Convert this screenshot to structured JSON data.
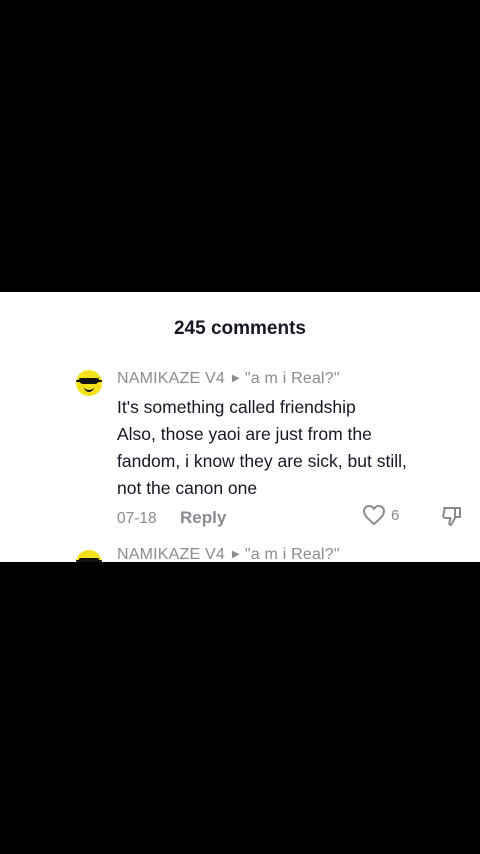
{
  "sheet": {
    "title": "245 comments"
  },
  "comments": [
    {
      "author": "NAMIKAZE V4",
      "reply_to": "\"a m i Real?\"",
      "lines": [
        "It's something called friendship",
        "Also, those yaoi are just from the",
        "fandom, i know they are sick, but still,",
        "not the canon one"
      ],
      "date": "07-18",
      "reply_label": "Reply",
      "likes": "6",
      "icons": [
        "avatar",
        "heart-icon",
        "dislike-icon"
      ]
    },
    {
      "author": "NAMIKAZE V4",
      "reply_to": "\"a m i Real?\""
    }
  ],
  "colors": {
    "primary_text": "#161823",
    "secondary_text": "#8a8b91",
    "backdrop": "#000000"
  }
}
